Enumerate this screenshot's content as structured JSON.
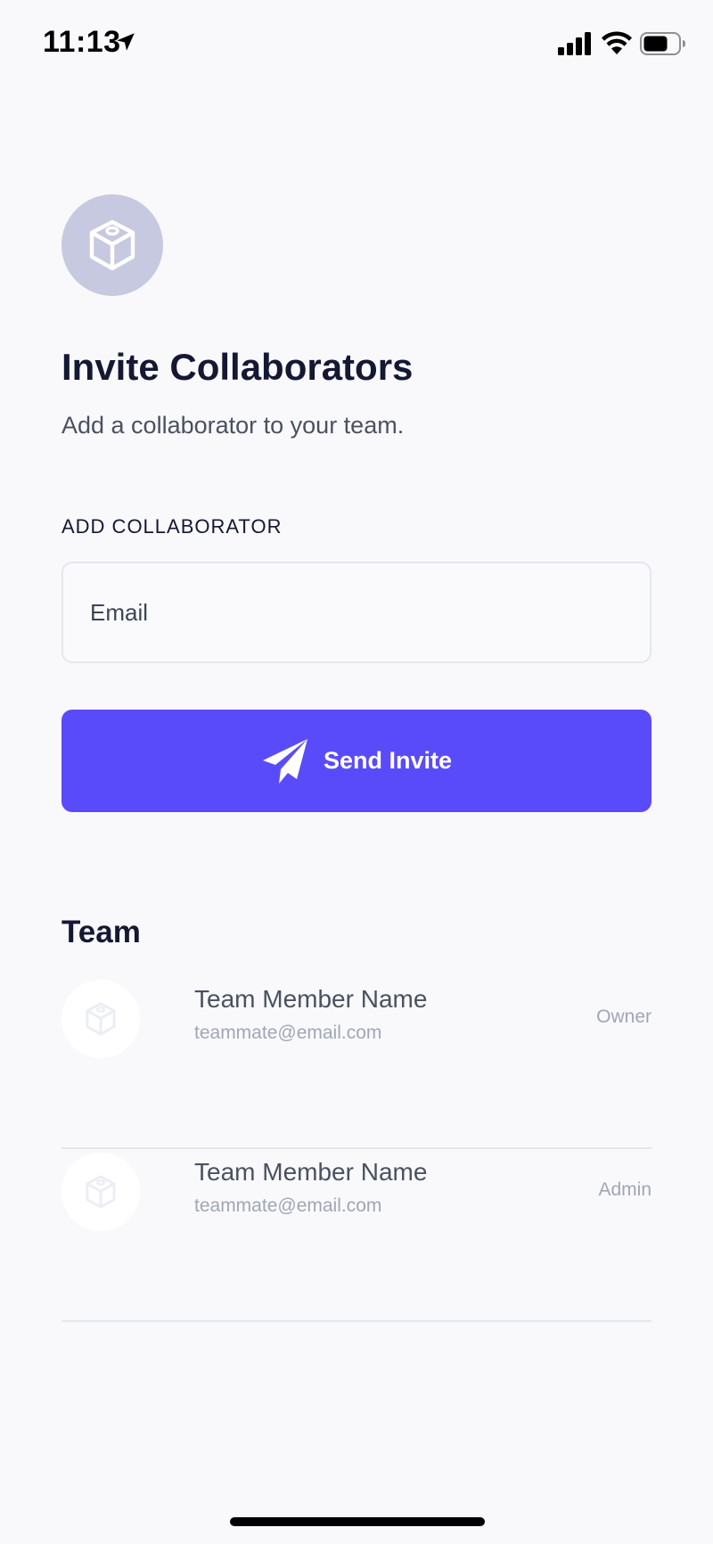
{
  "status_bar": {
    "time": "11:13"
  },
  "header": {
    "app_icon": "cube-icon",
    "title": "Invite Collaborators",
    "subtitle": "Add a collaborator to your team."
  },
  "invite_form": {
    "section_label": "ADD COLLABORATOR",
    "email_placeholder": "Email",
    "email_value": "",
    "send_label": "Send Invite",
    "send_icon": "paper-plane-icon",
    "accent_color": "#5a4bfa"
  },
  "team": {
    "heading": "Team",
    "members": [
      {
        "name": "Team Member Name",
        "email": "teammate@email.com",
        "role": "Owner"
      },
      {
        "name": "Team Member Name",
        "email": "teammate@email.com",
        "role": "Admin"
      }
    ]
  }
}
